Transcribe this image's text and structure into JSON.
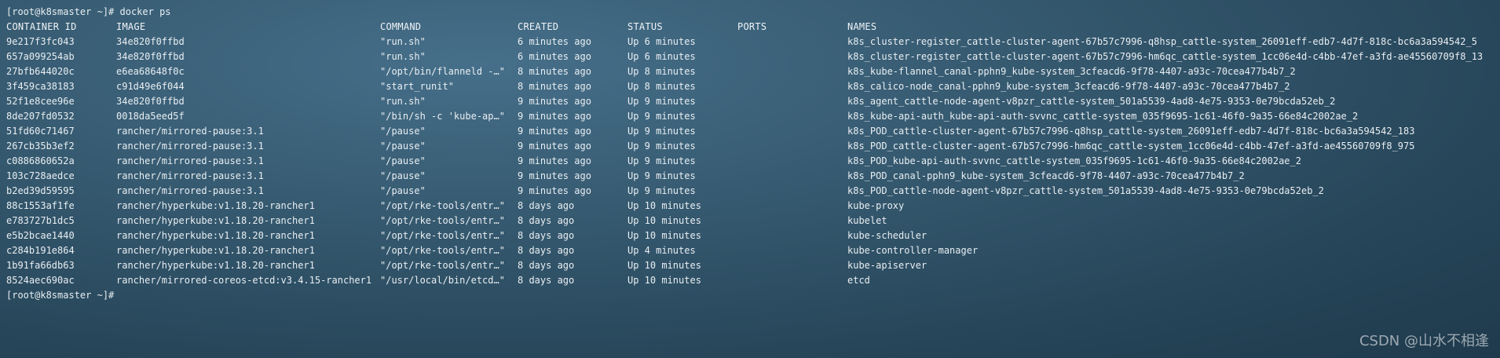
{
  "terminal": {
    "prompt_top": "[root@k8smaster ~]# docker ps",
    "prompt_bottom": "[root@k8smaster ~]#",
    "headers": {
      "container_id": "CONTAINER ID",
      "image": "IMAGE",
      "command": "COMMAND",
      "created": "CREATED",
      "status": "STATUS",
      "ports": "PORTS",
      "names": "NAMES"
    },
    "rows": [
      {
        "id": "9e217f3fc043",
        "image": "34e820f0ffbd",
        "command": "\"run.sh\"",
        "created": "6 minutes ago",
        "status": "Up 6 minutes",
        "ports": "",
        "names": "k8s_cluster-register_cattle-cluster-agent-67b57c7996-q8hsp_cattle-system_26091eff-edb7-4d7f-818c-bc6a3a594542_5"
      },
      {
        "id": "657a099254ab",
        "image": "34e820f0ffbd",
        "command": "\"run.sh\"",
        "created": "6 minutes ago",
        "status": "Up 6 minutes",
        "ports": "",
        "names": "k8s_cluster-register_cattle-cluster-agent-67b57c7996-hm6qc_cattle-system_1cc06e4d-c4bb-47ef-a3fd-ae45560709f8_13"
      },
      {
        "id": "27bfb644020c",
        "image": "e6ea68648f0c",
        "command": "\"/opt/bin/flanneld -…\"",
        "created": "8 minutes ago",
        "status": "Up 8 minutes",
        "ports": "",
        "names": "k8s_kube-flannel_canal-pphn9_kube-system_3cfeacd6-9f78-4407-a93c-70cea477b4b7_2"
      },
      {
        "id": "3f459ca38183",
        "image": "c91d49e6f044",
        "command": "\"start_runit\"",
        "created": "8 minutes ago",
        "status": "Up 8 minutes",
        "ports": "",
        "names": "k8s_calico-node_canal-pphn9_kube-system_3cfeacd6-9f78-4407-a93c-70cea477b4b7_2"
      },
      {
        "id": "52f1e8cee96e",
        "image": "34e820f0ffbd",
        "command": "\"run.sh\"",
        "created": "9 minutes ago",
        "status": "Up 9 minutes",
        "ports": "",
        "names": "k8s_agent_cattle-node-agent-v8pzr_cattle-system_501a5539-4ad8-4e75-9353-0e79bcda52eb_2"
      },
      {
        "id": "8de207fd0532",
        "image": "0018da5eed5f",
        "command": "\"/bin/sh -c 'kube-ap…\"",
        "created": "9 minutes ago",
        "status": "Up 9 minutes",
        "ports": "",
        "names": "k8s_kube-api-auth_kube-api-auth-svvnc_cattle-system_035f9695-1c61-46f0-9a35-66e84c2002ae_2"
      },
      {
        "id": "51fd60c71467",
        "image": "rancher/mirrored-pause:3.1",
        "command": "\"/pause\"",
        "created": "9 minutes ago",
        "status": "Up 9 minutes",
        "ports": "",
        "names": "k8s_POD_cattle-cluster-agent-67b57c7996-q8hsp_cattle-system_26091eff-edb7-4d7f-818c-bc6a3a594542_183"
      },
      {
        "id": "267cb35b3ef2",
        "image": "rancher/mirrored-pause:3.1",
        "command": "\"/pause\"",
        "created": "9 minutes ago",
        "status": "Up 9 minutes",
        "ports": "",
        "names": "k8s_POD_cattle-cluster-agent-67b57c7996-hm6qc_cattle-system_1cc06e4d-c4bb-47ef-a3fd-ae45560709f8_975"
      },
      {
        "id": "c0886860652a",
        "image": "rancher/mirrored-pause:3.1",
        "command": "\"/pause\"",
        "created": "9 minutes ago",
        "status": "Up 9 minutes",
        "ports": "",
        "names": "k8s_POD_kube-api-auth-svvnc_cattle-system_035f9695-1c61-46f0-9a35-66e84c2002ae_2"
      },
      {
        "id": "103c728aedce",
        "image": "rancher/mirrored-pause:3.1",
        "command": "\"/pause\"",
        "created": "9 minutes ago",
        "status": "Up 9 minutes",
        "ports": "",
        "names": "k8s_POD_canal-pphn9_kube-system_3cfeacd6-9f78-4407-a93c-70cea477b4b7_2"
      },
      {
        "id": "b2ed39d59595",
        "image": "rancher/mirrored-pause:3.1",
        "command": "\"/pause\"",
        "created": "9 minutes ago",
        "status": "Up 9 minutes",
        "ports": "",
        "names": "k8s_POD_cattle-node-agent-v8pzr_cattle-system_501a5539-4ad8-4e75-9353-0e79bcda52eb_2"
      },
      {
        "id": "88c1553af1fe",
        "image": "rancher/hyperkube:v1.18.20-rancher1",
        "command": "\"/opt/rke-tools/entr…\"",
        "created": "8 days ago",
        "status": "Up 10 minutes",
        "ports": "",
        "names": "kube-proxy"
      },
      {
        "id": "e783727b1dc5",
        "image": "rancher/hyperkube:v1.18.20-rancher1",
        "command": "\"/opt/rke-tools/entr…\"",
        "created": "8 days ago",
        "status": "Up 10 minutes",
        "ports": "",
        "names": "kubelet"
      },
      {
        "id": "e5b2bcae1440",
        "image": "rancher/hyperkube:v1.18.20-rancher1",
        "command": "\"/opt/rke-tools/entr…\"",
        "created": "8 days ago",
        "status": "Up 10 minutes",
        "ports": "",
        "names": "kube-scheduler"
      },
      {
        "id": "c284b191e864",
        "image": "rancher/hyperkube:v1.18.20-rancher1",
        "command": "\"/opt/rke-tools/entr…\"",
        "created": "8 days ago",
        "status": "Up 4 minutes",
        "ports": "",
        "names": "kube-controller-manager"
      },
      {
        "id": "1b91fa66db63",
        "image": "rancher/hyperkube:v1.18.20-rancher1",
        "command": "\"/opt/rke-tools/entr…\"",
        "created": "8 days ago",
        "status": "Up 10 minutes",
        "ports": "",
        "names": "kube-apiserver"
      },
      {
        "id": "8524aec690ac",
        "image": "rancher/mirrored-coreos-etcd:v3.4.15-rancher1",
        "command": "\"/usr/local/bin/etcd…\"",
        "created": "8 days ago",
        "status": "Up 10 minutes",
        "ports": "",
        "names": "etcd"
      }
    ]
  },
  "watermark": "CSDN @山水不相逢"
}
